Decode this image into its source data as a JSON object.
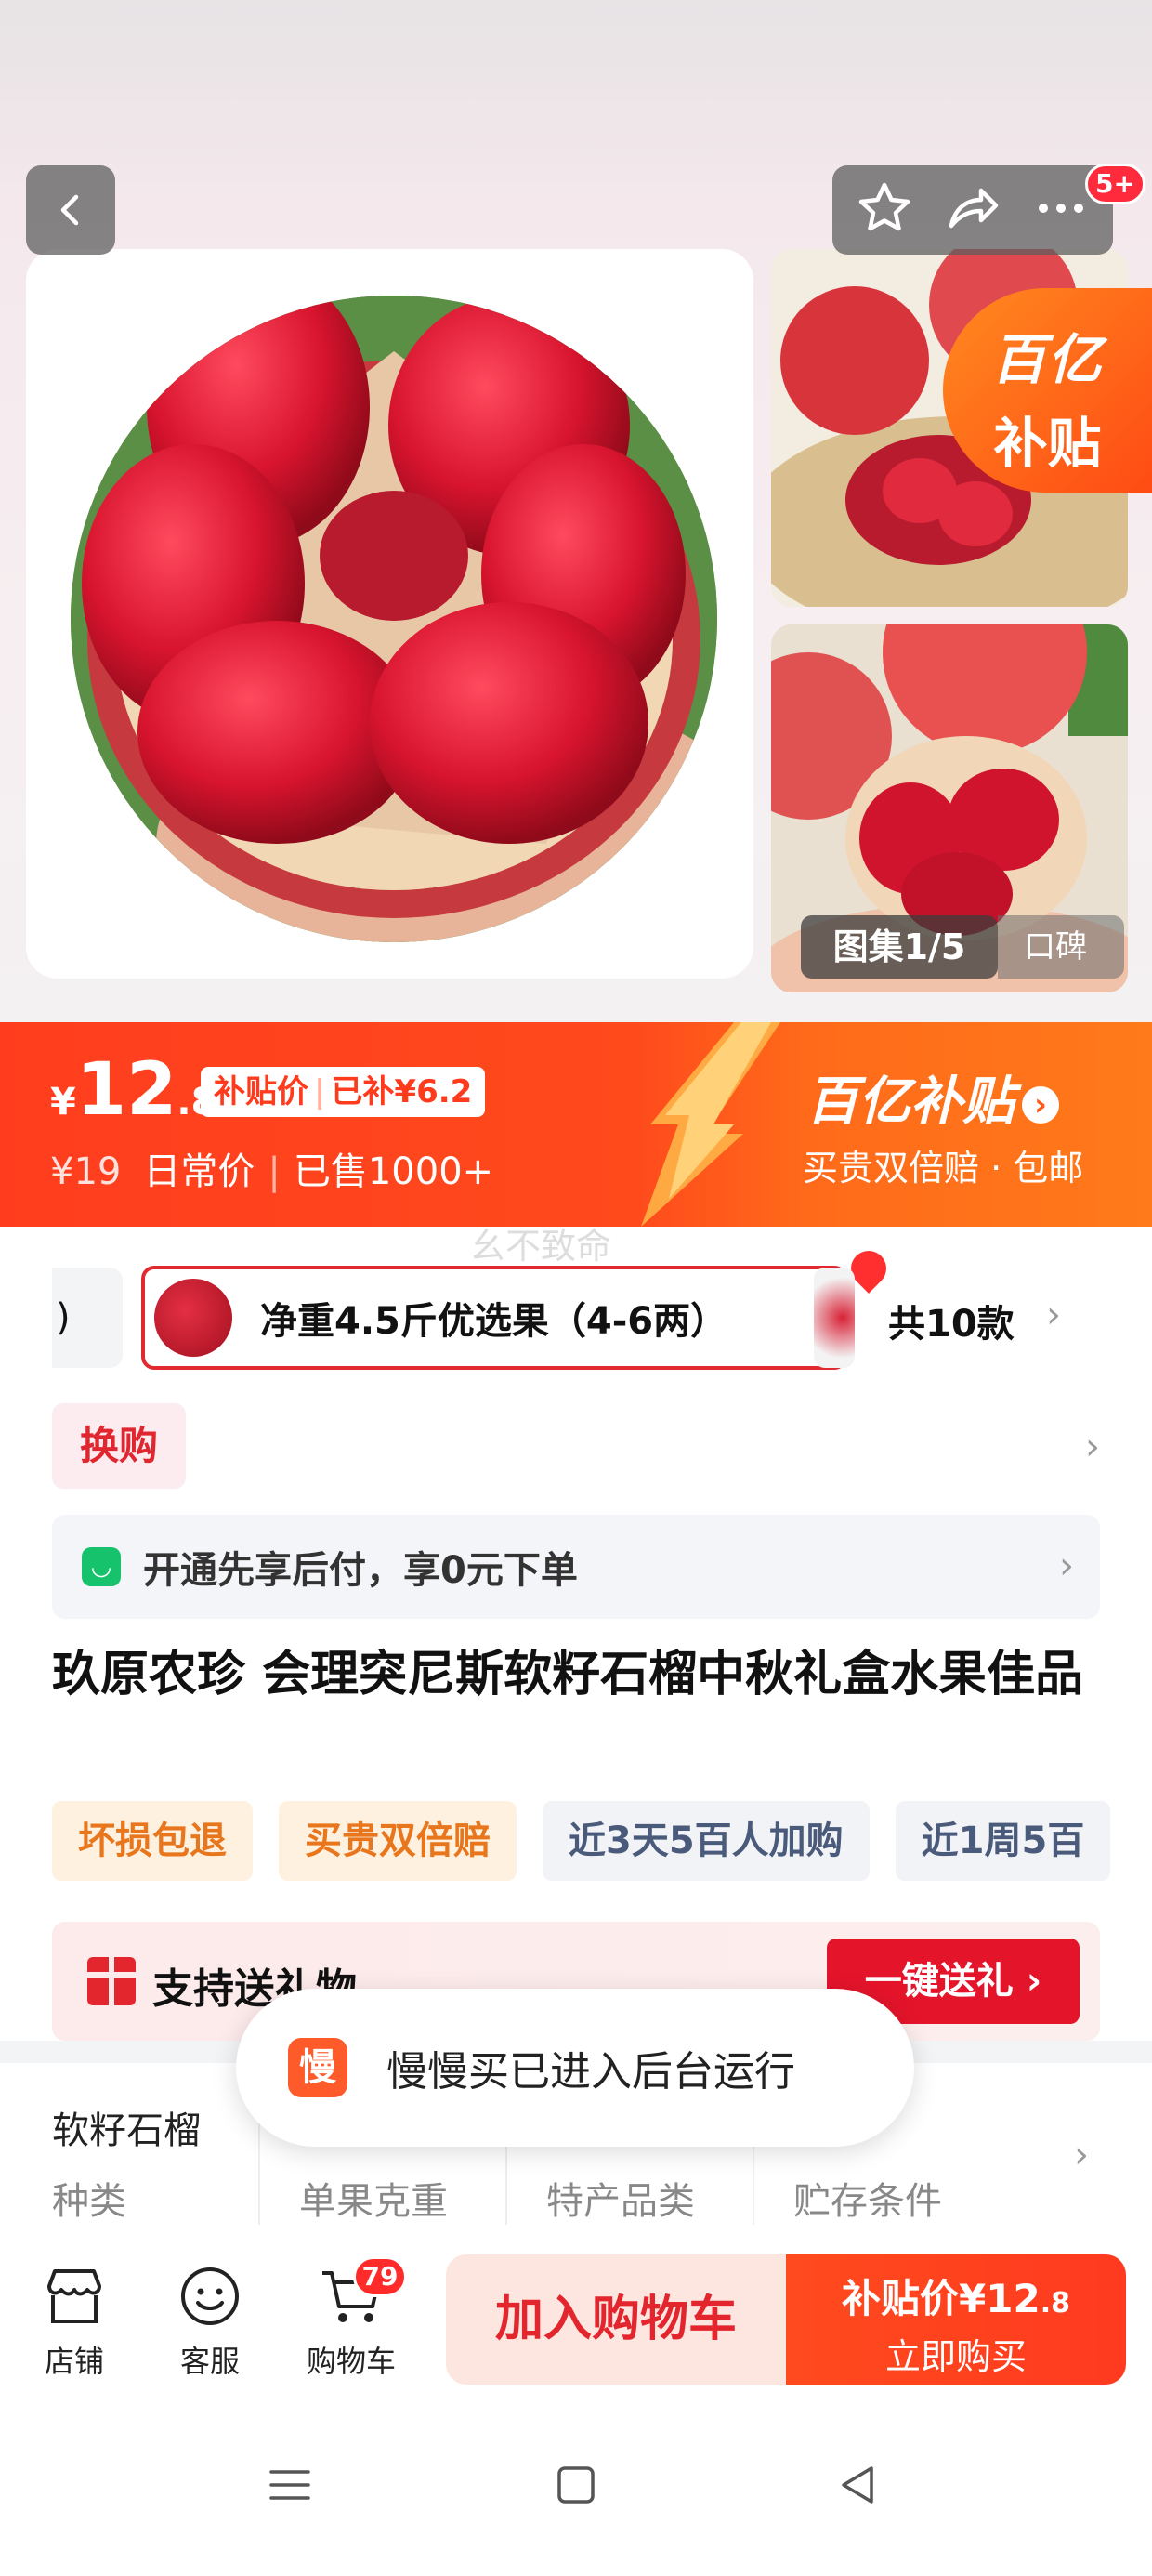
{
  "header": {
    "notification_count": "5+"
  },
  "gallery": {
    "badge_line1": "百亿",
    "badge_line2": "补贴",
    "album_label": "图集1/5",
    "koubei_label": "口碑"
  },
  "price_banner": {
    "currency": "¥",
    "price_int": "12",
    "price_dec": ".8",
    "tag_subsidy": "补贴价",
    "tag_subsidized": "已补¥6.2",
    "original_price": "¥19",
    "daily_price_label": "日常价",
    "sold": "已售1000+",
    "program_title": "百亿补贴",
    "program_arrow": "›",
    "program_sub": "买贵双倍赔 · 包邮"
  },
  "watermark": "幺不致命",
  "sku": {
    "prev_label": ")",
    "selected_label": "净重4.5斤优选果（4-6两）",
    "total_label": "共10款",
    "chevron": "›"
  },
  "huangou": {
    "label": "换购",
    "chevron": "›"
  },
  "pay_later": {
    "icon": "◡",
    "text": "开通先享后付，享0元下单",
    "chevron": "›"
  },
  "product": {
    "title": "玖原农珍 会理突尼斯软籽石榴中秋礼盒水果佳品"
  },
  "tags": {
    "items": [
      "坏损包退",
      "买贵双倍赔",
      "近3天5百人加购",
      "近1周5百"
    ]
  },
  "gift": {
    "text": "支持送礼物",
    "button": "一键送礼 ›"
  },
  "spec": {
    "first_value": "软籽石榴",
    "keys": [
      "种类",
      "单果克重",
      "特产品类",
      "贮存条件"
    ],
    "chevron": "›"
  },
  "toast": {
    "icon_char": "慢",
    "text": "慢慢买已进入后台运行"
  },
  "bottom_bar": {
    "shop_label": "店铺",
    "service_label": "客服",
    "cart_label": "购物车",
    "cart_count": "79",
    "add_to_cart": "加入购物车",
    "buy_price_prefix": "补贴价¥12",
    "buy_price_dec": ".8",
    "buy_label": "立即购买"
  },
  "colors": {
    "brand_red": "#e3262d",
    "banner_orange": "#ff4a1c",
    "subsidy_orange": "#ff7a1a"
  }
}
